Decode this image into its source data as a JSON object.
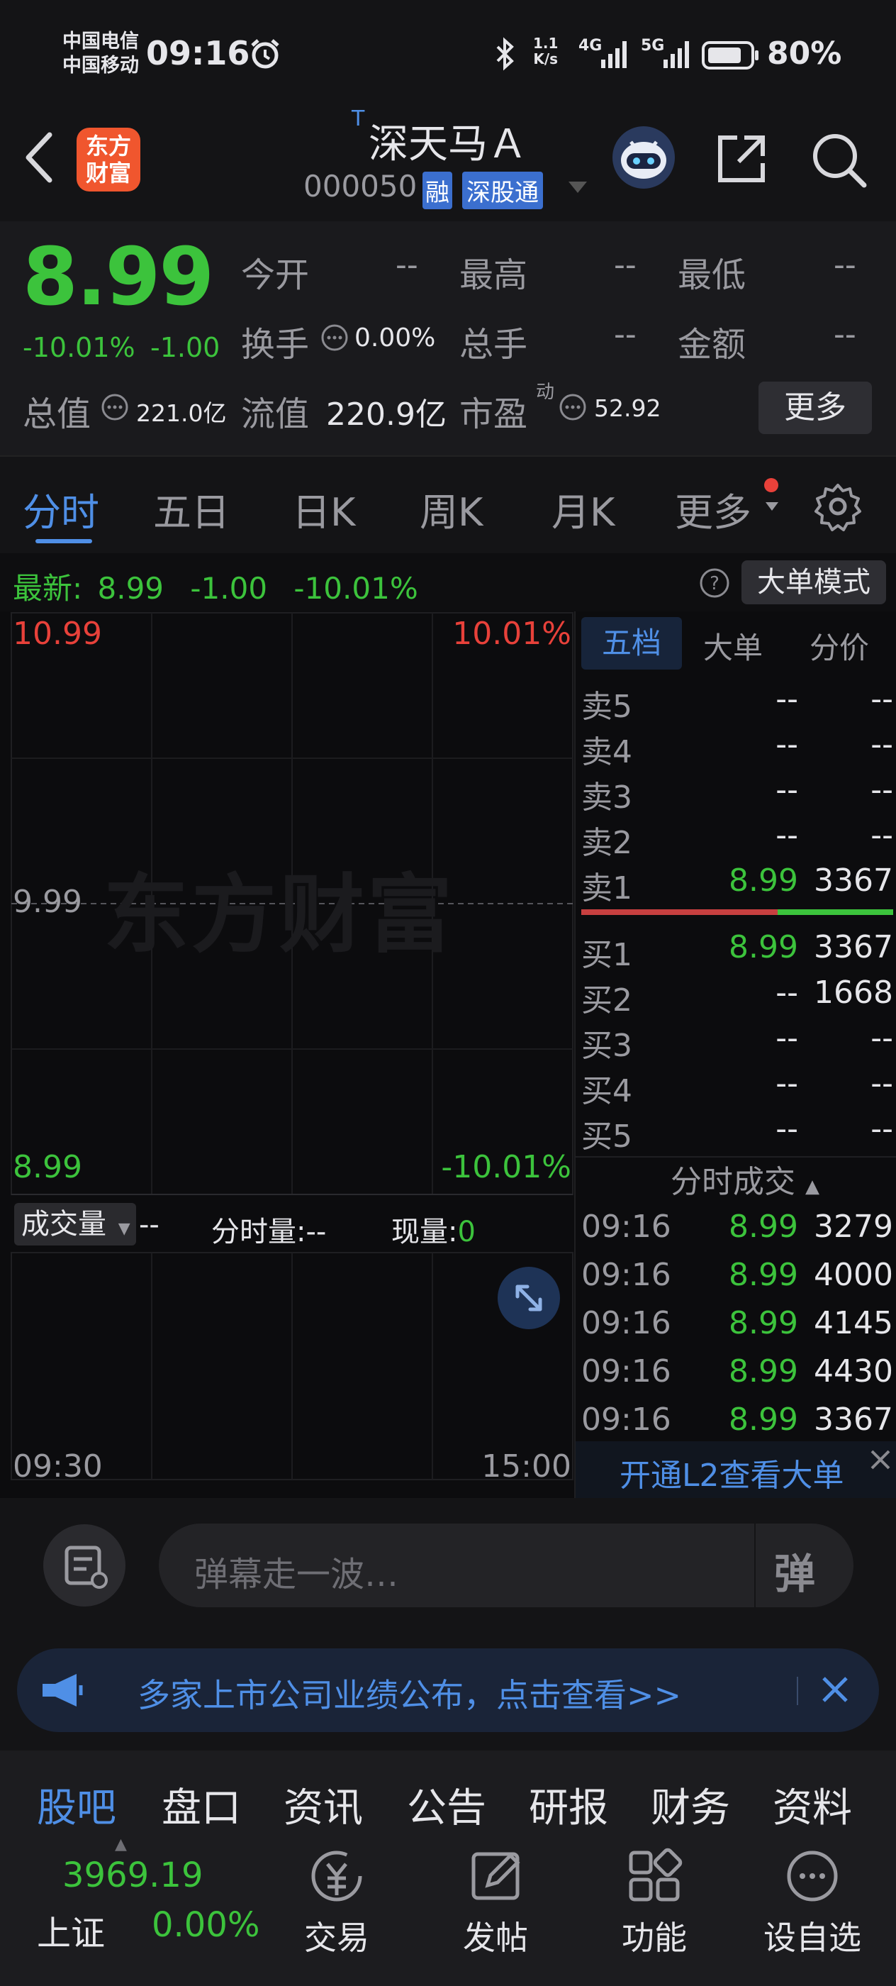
{
  "status_bar": {
    "carrier1": "中国电信",
    "carrier2": "中国移动",
    "time": "09:16",
    "net_speed_top": "1.1",
    "net_speed_unit": "K/s",
    "signal1": "4G",
    "signal2": "5G",
    "battery": "80%"
  },
  "header": {
    "app_logo_line1": "东方",
    "app_logo_line2": "财富",
    "stock_prefix": "T",
    "stock_name": "深天马Ａ",
    "stock_code": "000050",
    "badge_margin": "融",
    "badge_connect": "深股通"
  },
  "quote": {
    "price": "8.99",
    "change_pct": "-10.01%",
    "change_amt": "-1.00",
    "fields": [
      {
        "label": "今开",
        "value": "--"
      },
      {
        "label": "最高",
        "value": "--"
      },
      {
        "label": "最低",
        "value": "--"
      },
      {
        "label": "换手",
        "value": "0.00%"
      },
      {
        "label": "总手",
        "value": "--"
      },
      {
        "label": "金额",
        "value": "--"
      },
      {
        "label": "总值",
        "value": "221.0亿"
      },
      {
        "label": "流值",
        "value": "220.9亿"
      },
      {
        "label": "市盈",
        "sup": "动",
        "value": "52.92"
      }
    ],
    "more_button": "更多"
  },
  "period_tabs": [
    "分时",
    "五日",
    "日K",
    "周K",
    "月K",
    "更多"
  ],
  "info_bar": {
    "latest_label": "最新:",
    "latest_price": "8.99",
    "latest_change": "-1.00",
    "latest_pct": "-10.01%",
    "big_order_button": "大单模式"
  },
  "chart": {
    "top_price": "10.99",
    "top_pct": "10.01%",
    "mid_price": "9.99",
    "bottom_price": "8.99",
    "bottom_pct": "-10.01%",
    "watermark": "东方财富",
    "volume_selector": "成交量",
    "volume_value": "--",
    "minute_volume_label": "分时量:",
    "minute_volume_value": "--",
    "current_volume_label": "现量:",
    "current_volume_value": "0",
    "time_start": "09:30",
    "time_end": "15:00"
  },
  "order_book": {
    "tabs": [
      "五档",
      "大单",
      "分价"
    ],
    "asks": [
      {
        "label": "卖5",
        "price": "--",
        "volume": "--"
      },
      {
        "label": "卖4",
        "price": "--",
        "volume": "--"
      },
      {
        "label": "卖3",
        "price": "--",
        "volume": "--"
      },
      {
        "label": "卖2",
        "price": "--",
        "volume": "--"
      },
      {
        "label": "卖1",
        "price": "8.99",
        "volume": "3367"
      }
    ],
    "bids": [
      {
        "label": "买1",
        "price": "8.99",
        "volume": "3367"
      },
      {
        "label": "买2",
        "price": "--",
        "volume": "1668"
      },
      {
        "label": "买3",
        "price": "--",
        "volume": "--"
      },
      {
        "label": "买4",
        "price": "--",
        "volume": "--"
      },
      {
        "label": "买5",
        "price": "--",
        "volume": "--"
      }
    ],
    "ask_bid_ratio": 0.63,
    "trades_title": "分时成交",
    "trades": [
      {
        "time": "09:16",
        "price": "8.99",
        "volume": "3279"
      },
      {
        "time": "09:16",
        "price": "8.99",
        "volume": "4000"
      },
      {
        "time": "09:16",
        "price": "8.99",
        "volume": "4145"
      },
      {
        "time": "09:16",
        "price": "8.99",
        "volume": "4430"
      },
      {
        "time": "09:16",
        "price": "8.99",
        "volume": "3367"
      }
    ],
    "l2_banner": "开通L2查看大单"
  },
  "danmu": {
    "placeholder": "弹幕走一波…",
    "send_glyph": "弹"
  },
  "announcement": {
    "text": "多家上市公司业绩公布，点击查看>>"
  },
  "section_tabs": [
    "股吧",
    "盘口",
    "资讯",
    "公告",
    "研报",
    "财务",
    "资料"
  ],
  "footer": {
    "index_value": "3969.19",
    "index_name": "上证",
    "index_pct": "0.00%",
    "buttons": [
      "交易",
      "发帖",
      "功能",
      "设自选"
    ]
  },
  "colors": {
    "up": "#e8413a",
    "down": "#3cc33c",
    "accent": "#4f8fe6",
    "background": "#141416"
  }
}
